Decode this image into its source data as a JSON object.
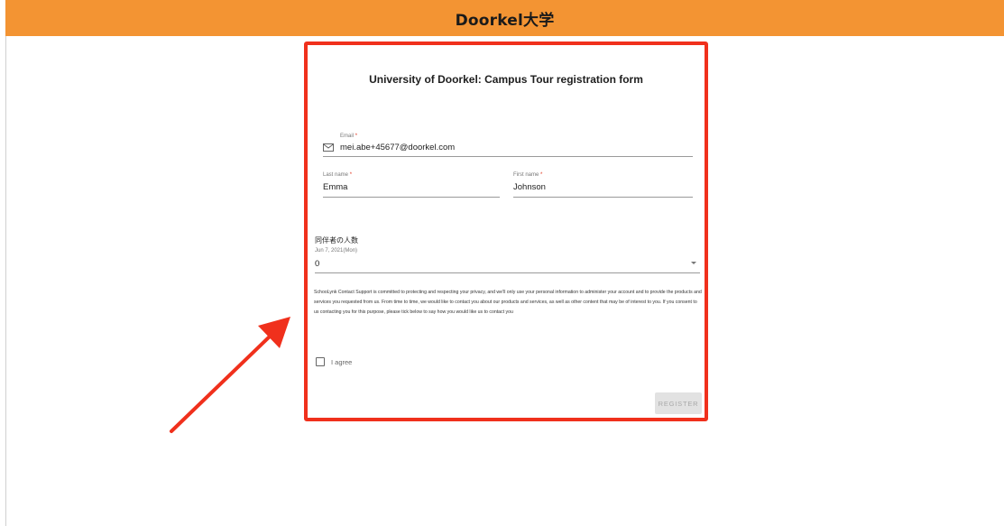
{
  "header": {
    "brand": "Doorkel大学",
    "background_color": "#f39433"
  },
  "form": {
    "title": "University of Doorkel: Campus Tour registration form",
    "highlight_color": "#f0301c",
    "email": {
      "label": "Email",
      "required_mark": "*",
      "value": "mei.abe+45677@doorkel.com",
      "icon": "mail-icon"
    },
    "last_name": {
      "label": "Last name",
      "required_mark": "*",
      "value": "Emma"
    },
    "first_name": {
      "label": "First name",
      "required_mark": "*",
      "value": "Johnson"
    },
    "companions": {
      "label": "同伴者の人数",
      "sub_label": "Jun 7, 2021(Mon)",
      "selected_value": "0",
      "icon": "dropdown-caret-icon"
    },
    "privacy_text": "SchooLynk Contact Support is committed to protecting and respecting your privacy, and we'll only use your personal information to administer your account and to provide the products and services you requested from us. From time to time, we would like to contact you about our products and services, as well as other content that may be of interest to you. If you consent to us contacting you for this purpose, please tick below to say how you would like us to contact you",
    "agree": {
      "label": "I agree",
      "checked": false
    },
    "register_button": {
      "label": "REGISTER",
      "enabled": false
    }
  },
  "annotation": {
    "arrow_color": "#f0301c"
  }
}
